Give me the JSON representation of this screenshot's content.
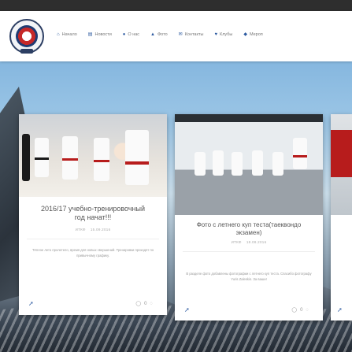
{
  "nav": {
    "items": [
      {
        "icon": "home-icon",
        "glyph": "⌂",
        "label": "Начало"
      },
      {
        "icon": "news-icon",
        "glyph": "▤",
        "label": "Новости"
      },
      {
        "icon": "about-icon",
        "glyph": "●",
        "label": "О нас"
      },
      {
        "icon": "photo-icon",
        "glyph": "▲",
        "label": "Фото"
      },
      {
        "icon": "contacts-icon",
        "glyph": "✉",
        "label": "Контакты"
      },
      {
        "icon": "clubs-icon",
        "glyph": "♥",
        "label": "Клубы"
      },
      {
        "icon": "events-icon",
        "glyph": "◆",
        "label": "Мероп"
      }
    ]
  },
  "cards": [
    {
      "title": "2016/17 учебно-тренировочный год начат!!!",
      "author": "ИТКФ",
      "date": "15.09.2016",
      "excerpt": "Тёплое лето пролетело, время для новых свершений. Тренировки проходят по привычному графику.",
      "comments": "0"
    },
    {
      "title": "Фото с летнего куп теста(таеквондо экзамен)",
      "author": "ИТКФ",
      "date": "18.08.2016",
      "excerpt": "В разделе фото добавлены фотографии с летнего куп теста. Спасибо фотографу Yuris Zaleskis. За ваши!",
      "comments": "0"
    }
  ]
}
